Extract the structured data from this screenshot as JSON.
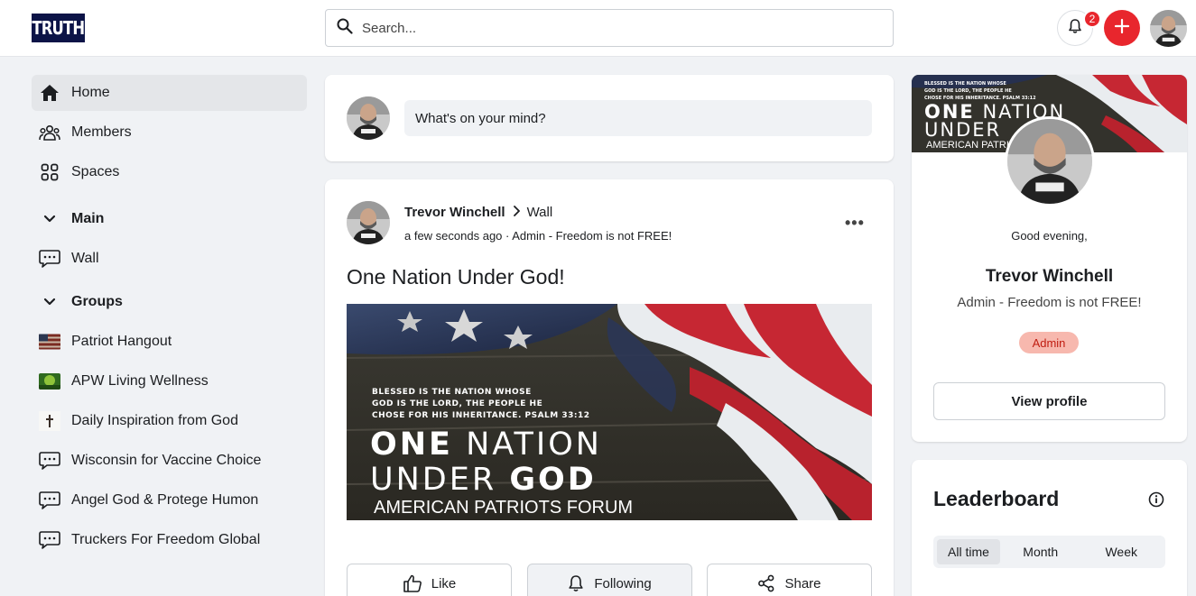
{
  "header": {
    "logo_text": "TRUTH",
    "search_placeholder": "Search...",
    "notification_count": "2"
  },
  "sidebar": {
    "items": [
      {
        "label": "Home",
        "icon": "home-icon"
      },
      {
        "label": "Members",
        "icon": "members-icon"
      },
      {
        "label": "Spaces",
        "icon": "spaces-icon"
      }
    ],
    "main_heading": "Main",
    "main_items": [
      {
        "label": "Wall",
        "icon": "chat-bubble-icon"
      }
    ],
    "groups_heading": "Groups",
    "groups": [
      {
        "label": "Patriot Hangout",
        "icon": "flag-thumbnail"
      },
      {
        "label": "APW Living Wellness",
        "icon": "nature-thumbnail"
      },
      {
        "label": "Daily Inspiration from God",
        "icon": "cross-thumbnail"
      },
      {
        "label": "Wisconsin for Vaccine Choice",
        "icon": "chat-bubble-icon"
      },
      {
        "label": "Angel God & Protege Humon",
        "icon": "chat-bubble-icon"
      },
      {
        "label": "Truckers For Freedom Global",
        "icon": "chat-bubble-icon"
      }
    ]
  },
  "composer": {
    "placeholder": "What's on your mind?"
  },
  "post": {
    "author": "Trevor Winchell",
    "destination": "Wall",
    "meta": "a few seconds ago · Admin - Freedom is not FREE!",
    "title": "One Nation Under God!",
    "image": {
      "verse_line1": "BLESSED IS THE NATION WHOSE",
      "verse_line2": "GOD IS THE LORD, THE PEOPLE HE",
      "verse_line3": "CHOSE FOR HIS INHERITANCE. PSALM 33:12",
      "headline_one": "ONE",
      "headline_nation": "NATION",
      "headline_under": "UNDER",
      "headline_god": "GOD",
      "footer": "AMERICAN PATRIOTS FORUM"
    },
    "actions": {
      "like": "Like",
      "following": "Following",
      "share": "Share"
    }
  },
  "profile": {
    "banner": {
      "verse_line1": "BLESSED IS THE NATION WHOSE",
      "verse_line2": "GOD IS THE LORD, THE PEOPLE HE",
      "verse_line3": "CHOSE FOR HIS INHERITANCE. PSALM 33:12",
      "headline_one": "ONE",
      "headline_nation": "NATION",
      "headline_under": "UNDER",
      "footer": "AMERICAN PATRIOTS FORUM"
    },
    "greeting": "Good evening,",
    "name": "Trevor Winchell",
    "tagline": "Admin - Freedom is not FREE!",
    "role": "Admin",
    "view_profile": "View profile"
  },
  "leaderboard": {
    "title": "Leaderboard",
    "tabs": [
      "All time",
      "Month",
      "Week"
    ],
    "selected_tab": "All time"
  },
  "colors": {
    "accent_red": "#e8262d",
    "logo_navy": "#0c1447",
    "role_badge_bg": "#f7b8ae",
    "role_badge_text": "#c01c10"
  }
}
